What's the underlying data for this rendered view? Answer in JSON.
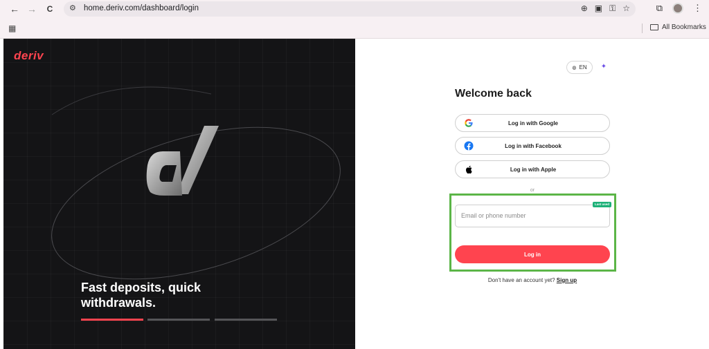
{
  "browser": {
    "url": "home.deriv.com/dashboard/login",
    "nav": {
      "back": "←",
      "forward": "→",
      "reload": "C"
    },
    "bookmarks": {
      "all_label": "All Bookmarks"
    }
  },
  "hero": {
    "logo": "deriv",
    "tagline": "Fast deposits, quick withdrawals.",
    "carousel": {
      "active_index": 0,
      "count": 3
    },
    "colors": {
      "brand": "#ff444f",
      "bg": "#141416"
    }
  },
  "login": {
    "language": "EN",
    "title": "Welcome back",
    "social": {
      "google": "Log in with Google",
      "facebook": "Log in with Facebook",
      "apple": "Log in with Apple"
    },
    "divider": "or",
    "email_placeholder": "Email or phone number",
    "last_used_badge": "Last used",
    "login_button": "Log in",
    "no_account": "Don't have an account yet?",
    "signup": "Sign up",
    "colors": {
      "primary": "#ff444f",
      "highlight_frame": "#5bb547",
      "badge": "#1db178"
    }
  }
}
